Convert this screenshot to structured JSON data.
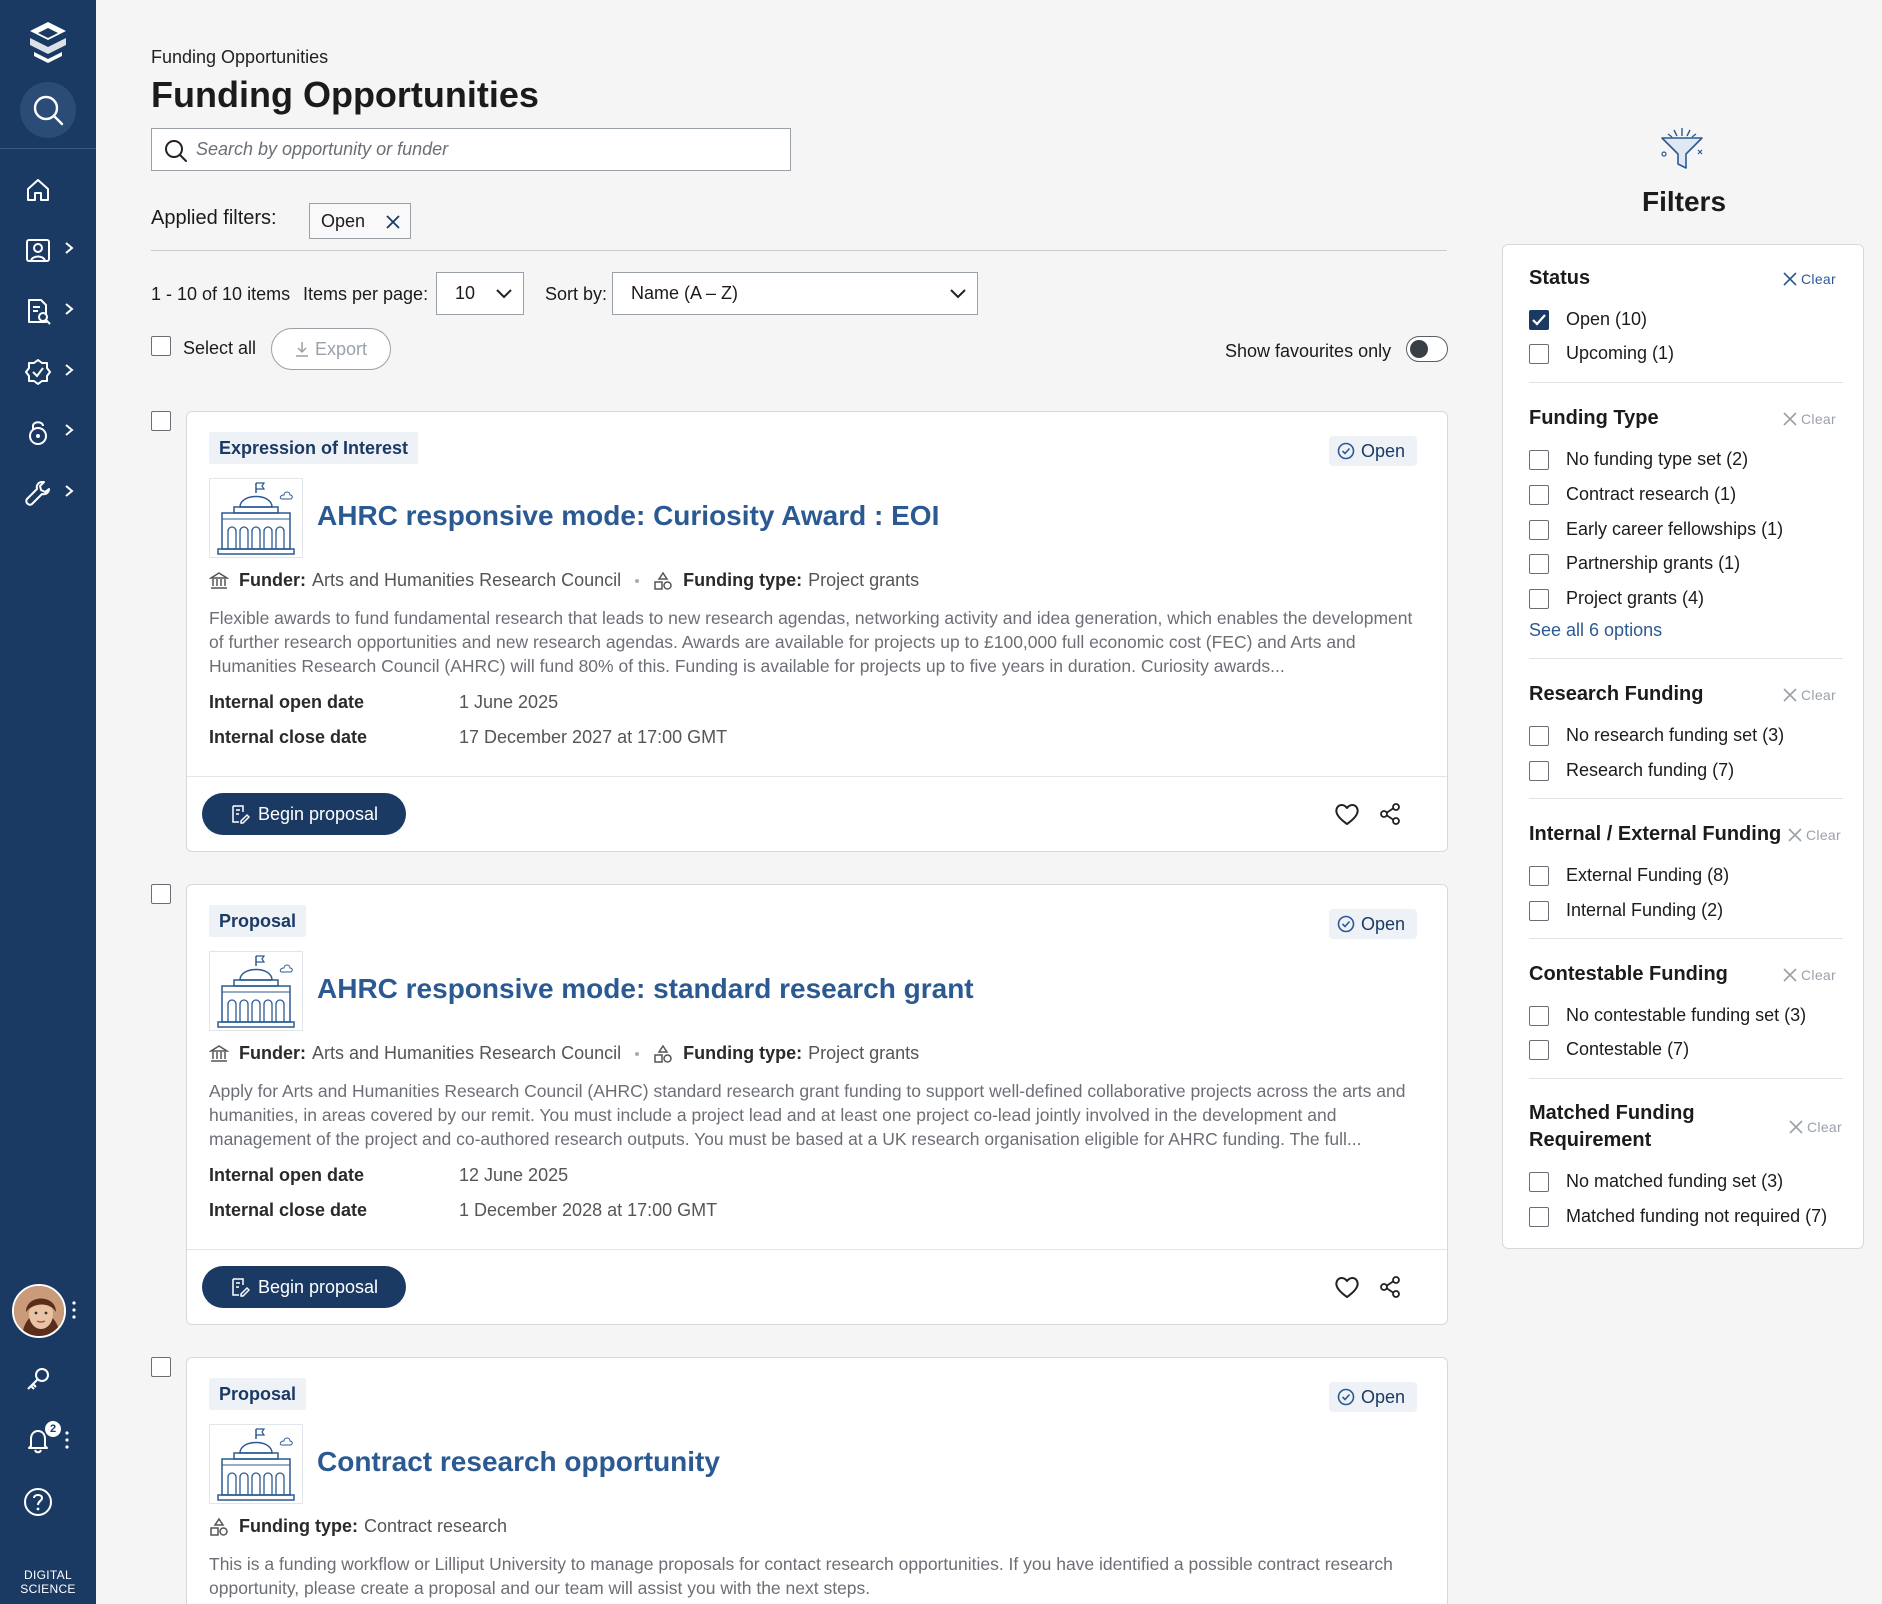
{
  "sidebar": {
    "brand_line1": "DIGITAL",
    "brand_line2": "SCIENCE",
    "notification_count": "2",
    "items": [
      {
        "icon": "home-icon"
      },
      {
        "icon": "profile-icon"
      },
      {
        "icon": "document-search-icon"
      },
      {
        "icon": "badge-check-icon"
      },
      {
        "icon": "lock-icon"
      },
      {
        "icon": "wrench-icon"
      }
    ]
  },
  "header": {
    "breadcrumb": "Funding Opportunities",
    "title": "Funding Opportunities"
  },
  "search": {
    "placeholder": "Search by opportunity or funder",
    "value": ""
  },
  "applied_filters": {
    "label": "Applied filters:",
    "chips": [
      "Open"
    ]
  },
  "toolbar": {
    "count": "1 - 10 of 10 items",
    "items_per_page_label": "Items per page:",
    "items_per_page_value": "10",
    "sort_label": "Sort by:",
    "sort_value": "Name (A – Z)",
    "select_all": "Select all",
    "export": "Export",
    "favourites_label": "Show favourites only",
    "favourites_on": false
  },
  "cards": [
    {
      "type": "Expression of Interest",
      "status": "Open",
      "title": "AHRC responsive mode: Curiosity Award : EOI",
      "funder_label": "Funder:",
      "funder": "Arts and Humanities Research Council",
      "funding_type_label": "Funding type:",
      "funding_type": "Project grants",
      "description": "Flexible awards to fund fundamental research that leads to new research agendas, networking activity and idea generation, which enables the development of further research opportunities and new research agendas. Awards are available for projects up to £100,000 full economic cost (FEC) and Arts and Humanities Research Council (AHRC) will fund 80% of this. Funding is available for projects up to five years in duration. Curiosity awards...",
      "open_label": "Internal open date",
      "open_date": "1 June 2025",
      "close_label": "Internal close date",
      "close_date": "17 December 2027 at 17:00 GMT",
      "action": "Begin proposal"
    },
    {
      "type": "Proposal",
      "status": "Open",
      "title": "AHRC responsive mode: standard research grant",
      "funder_label": "Funder:",
      "funder": "Arts and Humanities Research Council",
      "funding_type_label": "Funding type:",
      "funding_type": "Project grants",
      "description": "Apply for Arts and Humanities Research Council (AHRC) standard research grant funding to support well-defined collaborative projects across the arts and humanities, in areas covered by our remit. You must include a project lead and at least one project co-lead jointly involved in the development and management of the project and co-authored research outputs. You must be based at a UK research organisation eligible for AHRC funding. The full...",
      "open_label": "Internal open date",
      "open_date": "12 June 2025",
      "close_label": "Internal close date",
      "close_date": "1 December 2028 at 17:00 GMT",
      "action": "Begin proposal"
    },
    {
      "type": "Proposal",
      "status": "Open",
      "title": "Contract research opportunity",
      "funding_type_label": "Funding type:",
      "funding_type": "Contract research",
      "description": "This is a funding workflow or Lilliput University to manage proposals for contact research opportunities. If you have identified a possible contract research opportunity, please create a proposal and our team will assist you with the next steps."
    }
  ],
  "filters": {
    "title": "Filters",
    "clear_label": "Clear",
    "see_all": "See all 6 options",
    "sections": [
      {
        "title": "Status",
        "options": [
          {
            "label": "Open (10)",
            "checked": true
          },
          {
            "label": "Upcoming (1)",
            "checked": false
          }
        ]
      },
      {
        "title": "Funding Type",
        "options": [
          {
            "label": "No funding type set (2)"
          },
          {
            "label": "Contract research (1)"
          },
          {
            "label": "Early career fellowships (1)"
          },
          {
            "label": "Partnership grants (1)"
          },
          {
            "label": "Project grants (4)"
          }
        ]
      },
      {
        "title": "Research Funding",
        "options": [
          {
            "label": "No research funding set (3)"
          },
          {
            "label": "Research funding (7)"
          }
        ]
      },
      {
        "title": "Internal / External Funding",
        "options": [
          {
            "label": "External Funding (8)"
          },
          {
            "label": "Internal Funding (2)"
          }
        ]
      },
      {
        "title": "Contestable Funding",
        "options": [
          {
            "label": "No contestable funding set (3)"
          },
          {
            "label": "Contestable (7)"
          }
        ]
      },
      {
        "title_line1": "Matched Funding",
        "title_line2": "Requirement",
        "options": [
          {
            "label": "No matched funding set (3)"
          },
          {
            "label": "Matched funding not required (7)"
          }
        ]
      }
    ]
  },
  "colors": {
    "sidebar": "#1a3a64",
    "accent": "#1a3a64",
    "link": "#2b5a92"
  }
}
